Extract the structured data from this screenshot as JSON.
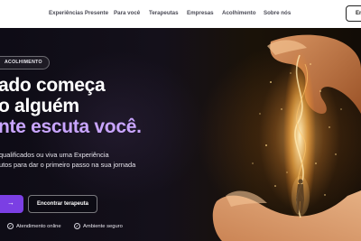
{
  "nav": {
    "items": [
      "Experiências Presente",
      "Para você",
      "Terapeutas",
      "Empresas",
      "Acolhimento",
      "Sobre nós"
    ],
    "button_label": "En"
  },
  "hero": {
    "badge": "ACOLHIMENTO",
    "headline": [
      "ado começa",
      "o alguém",
      "nte escuta você."
    ],
    "subtitle": [
      "qualificados ou viva uma Experiência",
      "utos para dar o primeiro passo na sua jornada"
    ],
    "primary_cta_icon": "arrow-right-icon",
    "secondary_cta": "Encontrar terapeuta",
    "features": [
      "Atendimento online",
      "Ambiente seguro"
    ]
  },
  "colors": {
    "accent": "#7b3fe4",
    "headline_accent": "#c9a5ff",
    "glow": "#ffb85a"
  }
}
